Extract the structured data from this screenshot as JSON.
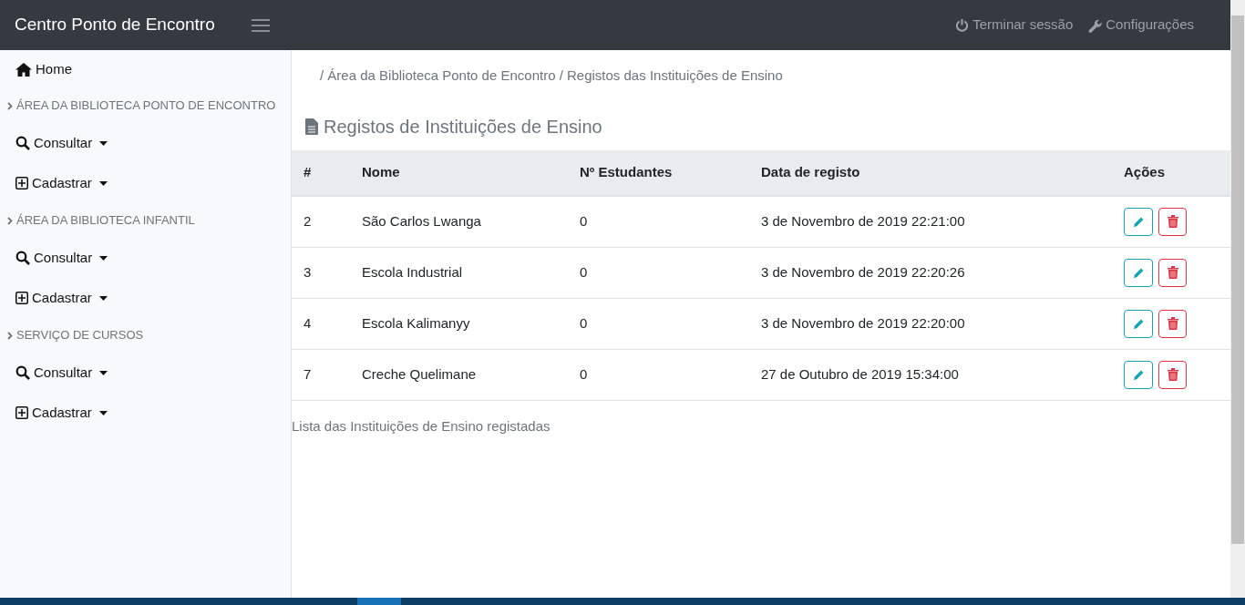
{
  "navbar": {
    "brand": "Centro Ponto de Encontro",
    "links": [
      {
        "kind": "power",
        "label": "Terminar sessão"
      },
      {
        "kind": "wrench",
        "label": "Configurações"
      }
    ]
  },
  "sidebar": {
    "home": "Home",
    "sections": [
      {
        "title": "ÁREA DA BIBLIOTECA PONTO DE ENCONTRO",
        "items": [
          {
            "kind": "search",
            "label": "Consultar"
          },
          {
            "kind": "plus",
            "label": "Cadastrar"
          }
        ]
      },
      {
        "title": "ÁREA DA BIBLIOTECA INFANTIL",
        "items": [
          {
            "kind": "search",
            "label": "Consultar"
          },
          {
            "kind": "plus",
            "label": "Cadastrar"
          }
        ]
      },
      {
        "title": "SERVIÇO DE CURSOS",
        "items": [
          {
            "kind": "search",
            "label": "Consultar"
          },
          {
            "kind": "plus",
            "label": "Cadastrar"
          }
        ]
      }
    ]
  },
  "breadcrumb": "/ Área da Biblioteca Ponto de Encontro / Registos das Instituições de Ensino",
  "heading": "Registos de Instituições de Ensino",
  "table": {
    "columns": [
      "#",
      "Nome",
      "Nº Estudantes",
      "Data de registo",
      "Ações"
    ],
    "rows": [
      [
        "2",
        "São Carlos Lwanga",
        "0",
        "3 de Novembro de 2019 22:21:00"
      ],
      [
        "3",
        "Escola Industrial",
        "0",
        "3 de Novembro de 2019 22:20:26"
      ],
      [
        "4",
        "Escola Kalimanyy",
        "0",
        "3 de Novembro de 2019 22:20:00"
      ],
      [
        "7",
        "Creche Quelimane",
        "0",
        "27 de Outubro de 2019 15:34:00"
      ]
    ]
  },
  "caption": "Lista das Instituições de Ensino registadas"
}
